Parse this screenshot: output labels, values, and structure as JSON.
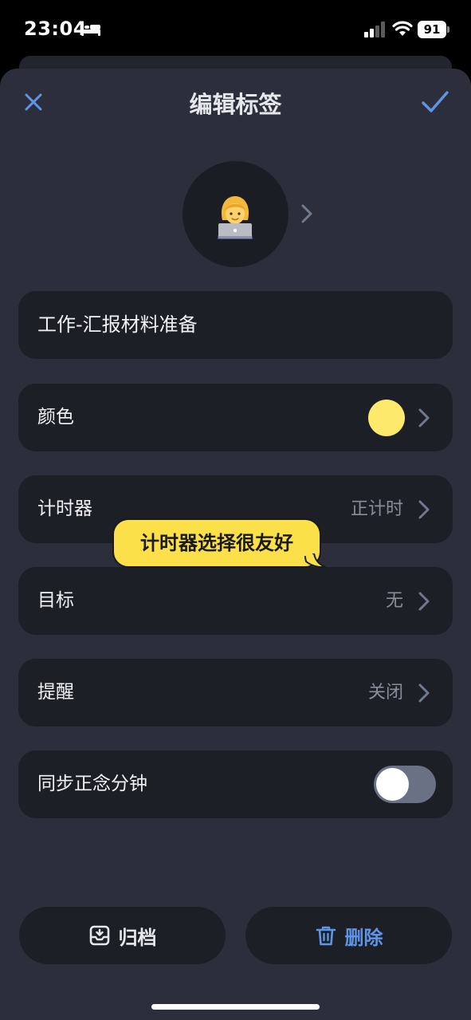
{
  "status_bar": {
    "time": "23:04",
    "battery": "91",
    "icons": [
      "bed-icon",
      "signal-icon",
      "wifi-icon",
      "battery-icon"
    ]
  },
  "header": {
    "title": "编辑标签",
    "close_icon": "close-icon",
    "confirm_icon": "checkmark-icon"
  },
  "avatar": {
    "emoji": "🧑‍💻",
    "icon": "woman-technologist-emoji"
  },
  "name_field": {
    "value": "工作-汇报材料准备"
  },
  "settings": {
    "color": {
      "label": "颜色",
      "swatch": "#fde96b"
    },
    "timer": {
      "label": "计时器",
      "value": "正计时"
    },
    "goal": {
      "label": "目标",
      "value": "无"
    },
    "reminder": {
      "label": "提醒",
      "value": "关闭"
    },
    "sync": {
      "label": "同步正念分钟",
      "enabled": false
    }
  },
  "callout": {
    "text": "计时器选择很友好",
    "color": "#fbe04a"
  },
  "actions": {
    "archive_label": "归档",
    "delete_label": "删除",
    "delete_color": "#5e95e6"
  },
  "colors": {
    "sheet_bg": "#2c2f3b",
    "row_bg": "#1d1f27",
    "accent": "#5e95e6"
  }
}
